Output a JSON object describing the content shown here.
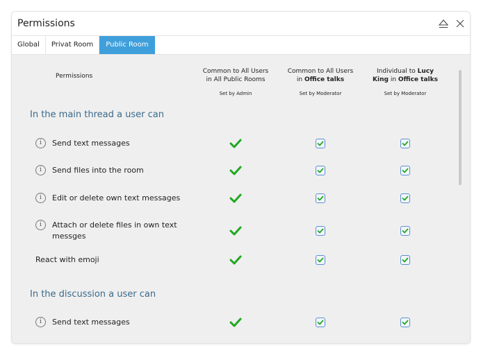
{
  "window": {
    "title": "Permissions",
    "icons": [
      "eject-icon",
      "close-icon"
    ]
  },
  "tabs": [
    {
      "label": "Global",
      "active": false
    },
    {
      "label": "Privat Room",
      "active": false
    },
    {
      "label": "Public Room",
      "active": true
    }
  ],
  "table": {
    "permissions_header": "Permissions",
    "columns": [
      {
        "line1": "Common to All Users",
        "line2_pre": "in ",
        "line2_bold": "",
        "line2": "All Public Rooms",
        "set_by": "Set by Admin"
      },
      {
        "line1": "Common to All Users",
        "line2_pre": "in ",
        "line2_bold": "Office talks",
        "line2": "",
        "set_by": "Set by Moderator"
      },
      {
        "line1_pre": "Individual to ",
        "line1_bold": "Lucy",
        "line2_bold_a": "King",
        "line2_mid": " in ",
        "line2_bold_b": "Office talks",
        "set_by": "Set by Moderator"
      }
    ],
    "sections": [
      {
        "title": "In the main thread a user can",
        "rows": [
          {
            "label": "Send text messages",
            "info": true,
            "admin": true,
            "room": true,
            "individual": true
          },
          {
            "label": "Send files into the room",
            "info": true,
            "admin": true,
            "room": true,
            "individual": true
          },
          {
            "label": "Edit or delete own text messages",
            "info": true,
            "admin": true,
            "room": true,
            "individual": true
          },
          {
            "label": "Attach or delete files in own text messges",
            "info": true,
            "admin": true,
            "room": true,
            "individual": true
          },
          {
            "label": "React with emoji",
            "info": false,
            "admin": true,
            "room": true,
            "individual": true
          }
        ]
      },
      {
        "title": "In the discussion a user can",
        "rows": [
          {
            "label": "Send text messages",
            "info": true,
            "admin": true,
            "room": true,
            "individual": true
          }
        ]
      }
    ]
  },
  "colors": {
    "accent": "#3f9fdb",
    "section_title": "#3a6a8c",
    "check_green": "#1fa81f",
    "checkbox_border": "#5b8fd0"
  }
}
